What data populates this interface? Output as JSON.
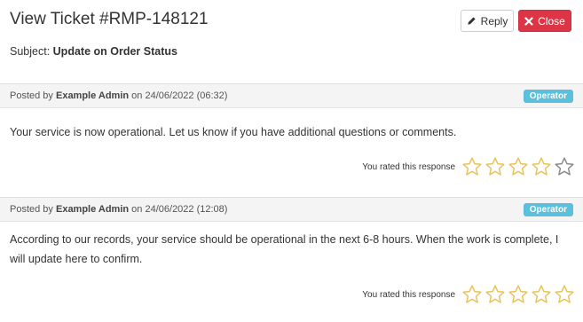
{
  "header": {
    "title": "View Ticket #RMP-148121",
    "reply_label": "Reply",
    "close_label": "Close"
  },
  "subject": {
    "label": "Subject:",
    "value": "Update on Order Status"
  },
  "posts": [
    {
      "posted_by_label": "Posted by",
      "author": "Example Admin",
      "on_label": "on",
      "datetime": "24/06/2022 (06:32)",
      "badge": "Operator",
      "body": "Your service is now operational. Let us know if you have additional questions or comments.",
      "rating_label": "You rated this response",
      "rating": 4,
      "max_rating": 5
    },
    {
      "posted_by_label": "Posted by",
      "author": "Example Admin",
      "on_label": "on",
      "datetime": "24/06/2022 (12:08)",
      "badge": "Operator",
      "body": "According to our records, your service should be operational in the next 6-8 hours. When the work is complete, I will update here to confirm.",
      "rating_label": "You rated this response",
      "rating": 5,
      "max_rating": 5
    }
  ],
  "colors": {
    "star_filled": "#e8c35a",
    "star_empty": "#8a8a8a",
    "badge": "#5bc0de",
    "close_button": "#dc3545"
  },
  "icons": {
    "reply": "pencil-icon",
    "close": "times-icon",
    "star": "star-icon"
  }
}
